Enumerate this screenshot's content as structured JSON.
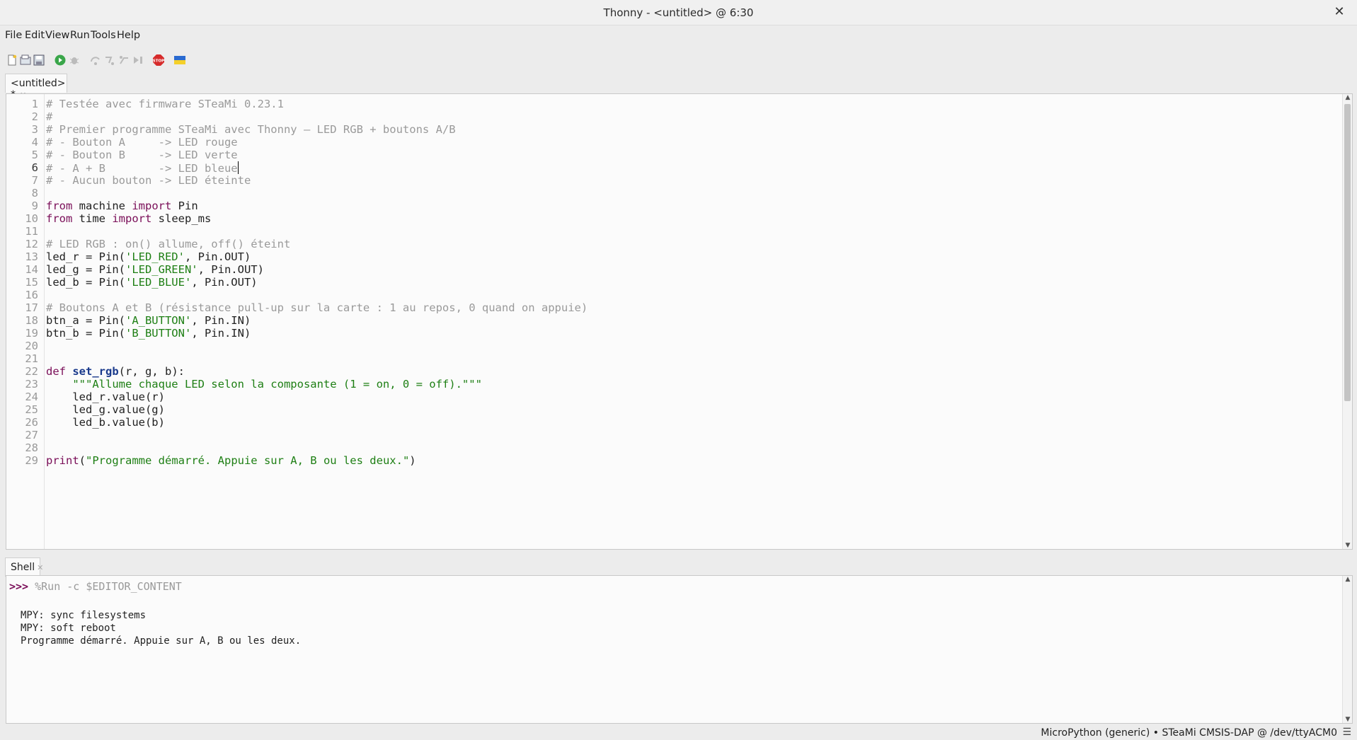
{
  "window": {
    "title": "Thonny  -  <untitled>  @  6:30"
  },
  "menu": [
    "File",
    "Edit",
    "View",
    "Run",
    "Tools",
    "Help"
  ],
  "toolbar": {
    "icons": [
      "new-file-icon",
      "open-file-icon",
      "save-file-icon",
      "run-icon",
      "debug-icon",
      "step-over-icon",
      "step-into-icon",
      "step-out-icon",
      "resume-icon",
      "stop-icon",
      "ukraine-flag-icon"
    ],
    "stop_label": "STOP"
  },
  "editor": {
    "tab_label": "<untitled> *",
    "current_line": 6,
    "lines": [
      "# Testée avec firmware STeaMi 0.23.1",
      "#",
      "# Premier programme STeaMi avec Thonny — LED RGB + boutons A/B",
      "# - Bouton A     -> LED rouge",
      "# - Bouton B     -> LED verte",
      "# - A + B        -> LED bleue",
      "# - Aucun bouton -> LED éteinte",
      "",
      "from machine import Pin",
      "from time import sleep_ms",
      "",
      "# LED RGB : on() allume, off() éteint",
      "led_r = Pin('LED_RED', Pin.OUT)",
      "led_g = Pin('LED_GREEN', Pin.OUT)",
      "led_b = Pin('LED_BLUE', Pin.OUT)",
      "",
      "# Boutons A et B (résistance pull-up sur la carte : 1 au repos, 0 quand on appuie)",
      "btn_a = Pin('A_BUTTON', Pin.IN)",
      "btn_b = Pin('B_BUTTON', Pin.IN)",
      "",
      "",
      "def set_rgb(r, g, b):",
      "    \"\"\"Allume chaque LED selon la composante (1 = on, 0 = off).\"\"\"",
      "    led_r.value(r)",
      "    led_g.value(g)",
      "    led_b.value(b)",
      "",
      "",
      "print(\"Programme démarré. Appuie sur A, B ou les deux.\")"
    ]
  },
  "shell": {
    "tab_label": "Shell",
    "prompt": ">>>",
    "command": "%Run -c $EDITOR_CONTENT",
    "output": [
      "MPY: sync filesystems",
      "MPY: soft reboot",
      "Programme démarré. Appuie sur A, B ou les deux."
    ]
  },
  "status": {
    "text": "MicroPython (generic)  •  STeaMi CMSIS-DAP @ /dev/ttyACM0"
  },
  "colors": {
    "keyword": "#7a0e58",
    "string": "#1e7f14",
    "comment": "#9a9a9a",
    "function": "#1a3a8c",
    "prompt": "#7a0e58"
  }
}
